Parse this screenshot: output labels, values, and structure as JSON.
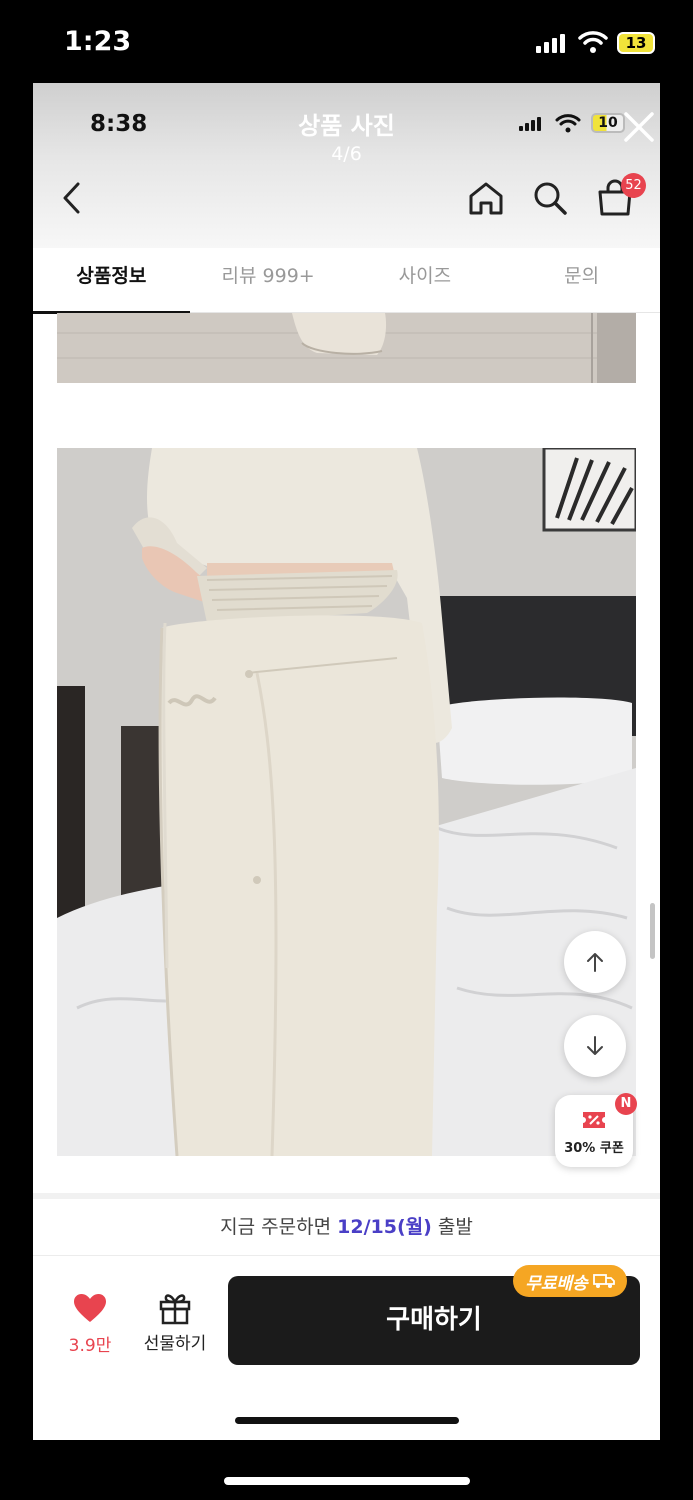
{
  "outer_status": {
    "time": "1:23",
    "battery": "13"
  },
  "inner_status": {
    "time": "8:38",
    "battery": "10"
  },
  "gallery": {
    "title": "상품 사진",
    "counter": "4/6"
  },
  "header": {
    "cart_count": "52"
  },
  "tabs": [
    {
      "label": "상품정보",
      "active": true
    },
    {
      "label": "리뷰 999+",
      "active": false
    },
    {
      "label": "사이즈",
      "active": false
    },
    {
      "label": "문의",
      "active": false
    }
  ],
  "coupon": {
    "label": "30% 쿠폰",
    "badge": "N"
  },
  "shipping": {
    "prefix": "지금 주문하면 ",
    "date": "12/15(월)",
    "suffix": " 출발"
  },
  "actions": {
    "like_count": "3.9만",
    "gift_label": "선물하기",
    "buy_label": "구매하기",
    "free_shipping": "무료배송"
  },
  "colors": {
    "accent": "#e8444f",
    "date": "#4a3fc6",
    "badge": "#f5a623",
    "button": "#1b1b1b"
  }
}
